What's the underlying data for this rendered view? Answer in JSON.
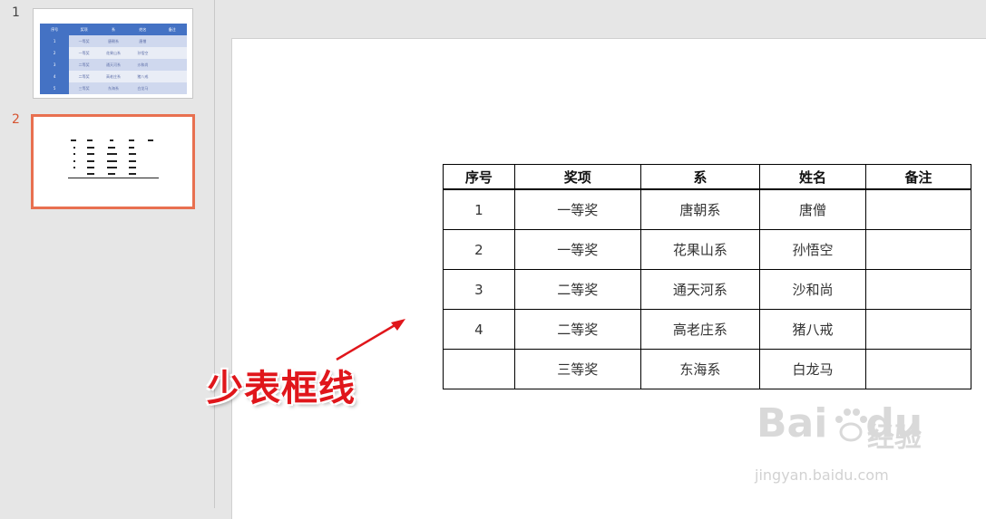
{
  "thumbnails": [
    {
      "number": "1"
    },
    {
      "number": "2"
    }
  ],
  "slide1_mini_table": {
    "headers": [
      "序号",
      "奖项",
      "系",
      "姓名",
      "备注"
    ],
    "rows": [
      [
        "1",
        "一等奖",
        "唐朝系",
        "唐僧",
        ""
      ],
      [
        "2",
        "一等奖",
        "花果山系",
        "孙悟空",
        ""
      ],
      [
        "3",
        "二等奖",
        "通天河系",
        "沙和尚",
        ""
      ],
      [
        "4",
        "二等奖",
        "高老庄系",
        "猪八戒",
        ""
      ],
      [
        "5",
        "三等奖",
        "东海系",
        "白龙马",
        ""
      ]
    ]
  },
  "table": {
    "headers": [
      "序号",
      "奖项",
      "系",
      "姓名",
      "备注"
    ],
    "rows": [
      [
        "1",
        "一等奖",
        "唐朝系",
        "唐僧",
        ""
      ],
      [
        "2",
        "一等奖",
        "花果山系",
        "孙悟空",
        ""
      ],
      [
        "3",
        "二等奖",
        "通天河系",
        "沙和尚",
        ""
      ],
      [
        "4",
        "二等奖",
        "高老庄系",
        "猪八戒",
        ""
      ],
      [
        "",
        "三等奖",
        "东海系",
        "白龙马",
        ""
      ]
    ]
  },
  "annotation": "少表框线",
  "watermark": {
    "brand": "Bai",
    "brand2": "du",
    "cn": "经验",
    "url": "jingyan.baidu.com"
  },
  "colors": {
    "accent_active": "#e87050",
    "annotation": "#e0161b",
    "table_header_blue": "#4472c4"
  }
}
